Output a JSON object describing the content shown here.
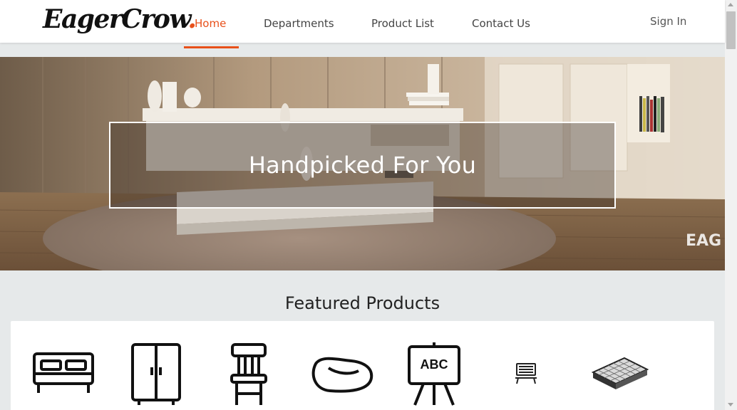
{
  "brand": {
    "name": "EagerCrow",
    "dot": ".",
    "accent_color": "#e8501a"
  },
  "nav": {
    "items": [
      {
        "label": "Home",
        "active": true
      },
      {
        "label": "Departments",
        "active": false
      },
      {
        "label": "Product List",
        "active": false
      },
      {
        "label": "Contact Us",
        "active": false
      }
    ],
    "signin_label": "Sign In"
  },
  "hero": {
    "title": "Handpicked For You",
    "watermark": "EAG"
  },
  "featured": {
    "title": "Featured Products",
    "categories": [
      {
        "icon": "bed-icon"
      },
      {
        "icon": "wardrobe-icon"
      },
      {
        "icon": "chair-icon"
      },
      {
        "icon": "bean-bag-icon"
      },
      {
        "icon": "easel-board-icon",
        "text": "ABC"
      },
      {
        "icon": "laptop-icon"
      },
      {
        "icon": "mattress-icon"
      }
    ]
  }
}
